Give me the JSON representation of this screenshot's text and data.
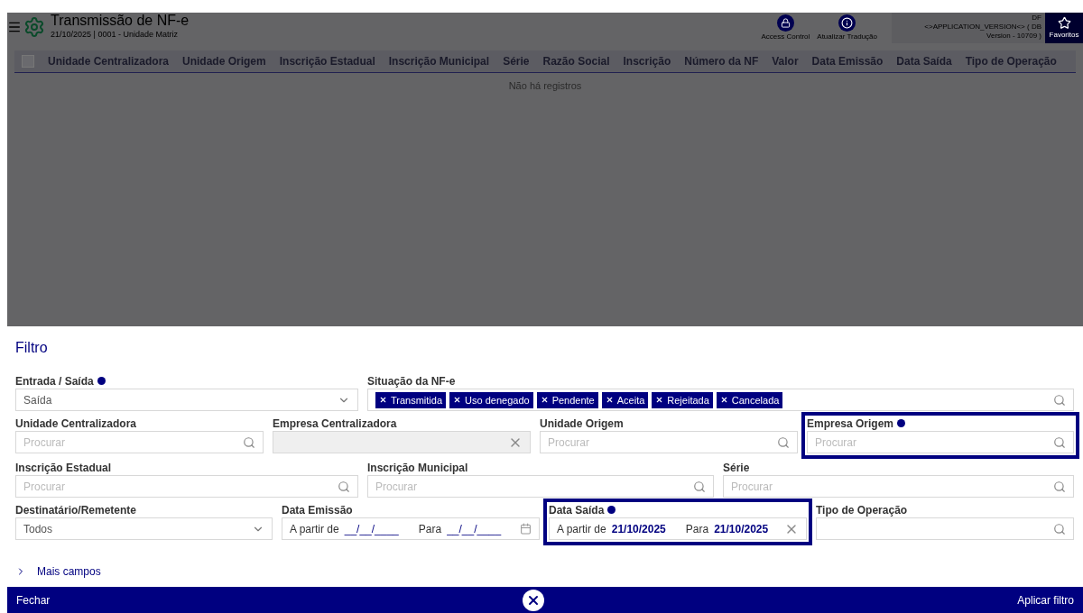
{
  "header": {
    "title": "Transmissão de NF-e",
    "subtitle": "21/10/2025 | 0001 - Unidade Matriz",
    "tools": [
      {
        "kind": "lock",
        "label": "Access Control"
      },
      {
        "kind": "info",
        "label": "Atualizar Tradução"
      }
    ],
    "version_lines": [
      "DF",
      "<>APPLICATION_VERSION<> ( DB",
      "Version - 10709 )"
    ],
    "favorites": "Favoritos"
  },
  "table": {
    "select_all_checked": false,
    "columns": [
      "Unidade Centralizadora",
      "Unidade Origem",
      "Inscrição Estadual",
      "Inscrição Municipal",
      "Série",
      "Razão Social",
      "Inscrição",
      "Número da NF",
      "Valor",
      "Data Emissão",
      "Data Saída",
      "Tipo de Operação"
    ],
    "empty_message": "Não há registros"
  },
  "filter": {
    "title": "Filtro",
    "rows": [
      [
        {
          "kind": "select",
          "label": "Entrada / Saída",
          "marker": true,
          "highlighted": false,
          "value": "Saída"
        },
        {
          "kind": "tags",
          "label": "Situação da NF-e",
          "marker": false,
          "highlighted": false,
          "tags": [
            "Transmitida",
            "Uso denegado",
            "Pendente",
            "Aceita",
            "Rejeitada",
            "Cancelada"
          ]
        }
      ],
      [
        {
          "kind": "search",
          "label": "Unidade Centralizadora",
          "marker": false,
          "highlighted": false,
          "placeholder": "Procurar"
        },
        {
          "kind": "disabled",
          "label": "Empresa Centralizadora",
          "marker": false,
          "highlighted": false
        },
        {
          "kind": "search",
          "label": "Unidade Origem",
          "marker": false,
          "highlighted": false,
          "placeholder": "Procurar"
        },
        {
          "kind": "search",
          "label": "Empresa Origem",
          "marker": true,
          "highlighted": true,
          "placeholder": "Procurar"
        }
      ],
      [
        {
          "kind": "search",
          "label": "Inscrição Estadual",
          "marker": false,
          "highlighted": false,
          "placeholder": "Procurar"
        },
        {
          "kind": "search",
          "label": "Inscrição Municipal",
          "marker": false,
          "highlighted": false,
          "placeholder": "Procurar"
        },
        {
          "kind": "search",
          "label": "Série",
          "marker": false,
          "highlighted": false,
          "placeholder": "Procurar"
        }
      ],
      [
        {
          "kind": "select",
          "label": "Destinatário/Remetente",
          "marker": false,
          "highlighted": false,
          "value": "Todos"
        },
        {
          "kind": "date_range",
          "label": "Data Emissão",
          "marker": false,
          "highlighted": false,
          "from_label": "A partir de",
          "from": "__/__/____",
          "to_label": "Para",
          "to": "__/__/____",
          "filled": false
        },
        {
          "kind": "date_range",
          "label": "Data Saída",
          "marker": true,
          "highlighted": true,
          "from_label": "A partir de",
          "from": "21/10/2025",
          "to_label": "Para",
          "to": "21/10/2025",
          "filled": true
        },
        {
          "kind": "multi",
          "label": "Tipo de Operação",
          "marker": false,
          "highlighted": false
        }
      ]
    ],
    "more_fields": "Mais campos"
  },
  "footer": {
    "close": "Fechar",
    "apply": "Aplicar filtro"
  }
}
